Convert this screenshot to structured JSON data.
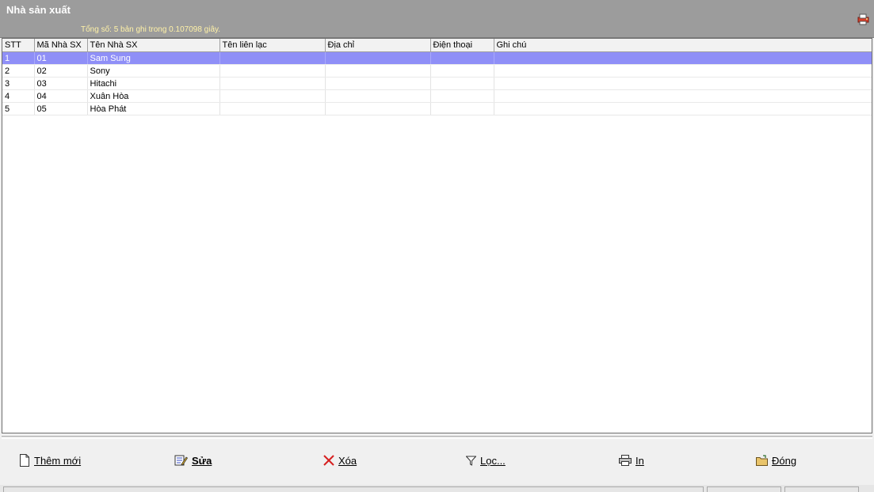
{
  "window": {
    "title": "Nhà sản xuất",
    "summary": "Tổng số: 5 bản ghi trong 0.107098 giây."
  },
  "table": {
    "columns": [
      "STT",
      "Mã Nhà SX",
      "Tên Nhà SX",
      "Tên liên lạc",
      "Địa chỉ",
      "Điện thoại",
      "Ghi chú"
    ],
    "rows": [
      [
        "1",
        "01",
        "Sam Sung",
        "",
        "",
        "",
        ""
      ],
      [
        "2",
        "02",
        "Sony",
        "",
        "",
        "",
        ""
      ],
      [
        "3",
        "03",
        "Hitachi",
        "",
        "",
        "",
        ""
      ],
      [
        "4",
        "04",
        "Xuân Hòa",
        "",
        "",
        "",
        ""
      ],
      [
        "5",
        "05",
        "Hòa Phát",
        "",
        "",
        "",
        ""
      ]
    ],
    "selected_row": 0
  },
  "toolbar": {
    "add_label": "Thêm mới",
    "edit_label": "Sửa",
    "delete_label": "Xóa",
    "filter_label": "Lọc...",
    "print_label": "In",
    "close_label": "Đóng"
  },
  "colors": {
    "header_bg": "#9c9c9c",
    "selected_row": "#8f8ff7",
    "summary_text": "#fff2a8"
  }
}
